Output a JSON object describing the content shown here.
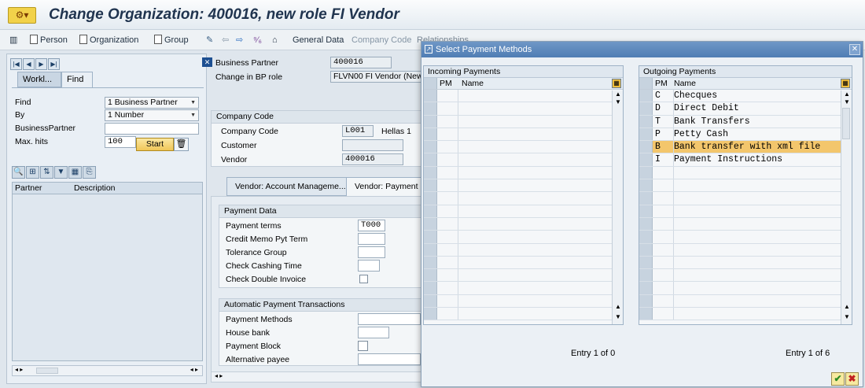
{
  "window": {
    "title": "Change Organization: 400016, new role FI Vendor",
    "icon": "sap-title-icon"
  },
  "toolbar": {
    "items": [
      "Person",
      "Organization",
      "Group"
    ],
    "general_data": "General Data",
    "company_code": "Company Code",
    "relationships": "Relationships"
  },
  "left_panel": {
    "tabs": [
      "Workl...",
      "Find"
    ],
    "find": {
      "label": "Find",
      "value": "1 Business Partner"
    },
    "by": {
      "label": "By",
      "value": "1 Number"
    },
    "business_partner": {
      "label": "BusinessPartner",
      "value": ""
    },
    "max_hits": {
      "label": "Max. hits",
      "value": "100"
    },
    "start_button": "Start",
    "columns": [
      "Partner",
      "Description"
    ]
  },
  "header": {
    "business_partner": {
      "label": "Business Partner",
      "value": "400016"
    },
    "change_role": {
      "label": "Change in BP role",
      "value": "FLVN00 FI Vendor (New)"
    }
  },
  "company_code_section": {
    "title": "Company Code",
    "company_code": {
      "label": "Company Code",
      "value": "L001",
      "desc": "Hellas 1"
    },
    "customer": {
      "label": "Customer",
      "value": ""
    },
    "vendor": {
      "label": "Vendor",
      "value": "400016"
    }
  },
  "vendor_tabs": [
    "Vendor: Account Manageme...",
    "Vendor: Payment"
  ],
  "payment_data": {
    "title": "Payment Data",
    "payment_terms": {
      "label": "Payment terms",
      "value": "T000"
    },
    "credit_memo": {
      "label": "Credit Memo Pyt Term",
      "value": ""
    },
    "tolerance_group": {
      "label": "Tolerance Group",
      "value": ""
    },
    "check_cashing": {
      "label": "Check Cashing Time",
      "value": ""
    },
    "check_double": {
      "label": "Check Double Invoice"
    }
  },
  "auto_payment": {
    "title": "Automatic Payment Transactions",
    "payment_methods": {
      "label": "Payment Methods",
      "value": ""
    },
    "house_bank": {
      "label": "House bank",
      "value": ""
    },
    "payment_block": {
      "label": "Payment Block"
    },
    "alternative_payee": {
      "label": "Alternative payee",
      "value": ""
    }
  },
  "dialog": {
    "title": "Select Payment Methods",
    "incoming": {
      "title": "Incoming Payments",
      "col_pm": "PM",
      "col_name": "Name",
      "rows": [],
      "entry": "Entry 1 of 0"
    },
    "outgoing": {
      "title": "Outgoing Payments",
      "col_pm": "PM",
      "col_name": "Name",
      "rows": [
        {
          "pm": "C",
          "name": "Checques"
        },
        {
          "pm": "D",
          "name": "Direct Debit"
        },
        {
          "pm": "T",
          "name": "Bank Transfers"
        },
        {
          "pm": "P",
          "name": "Petty Cash"
        },
        {
          "pm": "B",
          "name": "Bank transfer with xml file"
        },
        {
          "pm": "I",
          "name": "Payment Instructions"
        }
      ],
      "selected_index": 4,
      "entry": "Entry 1 of 6"
    }
  },
  "colors": {
    "title_text": "#20344f",
    "highlight": "#f3c66c",
    "dialog_title": "#5a86bb"
  }
}
